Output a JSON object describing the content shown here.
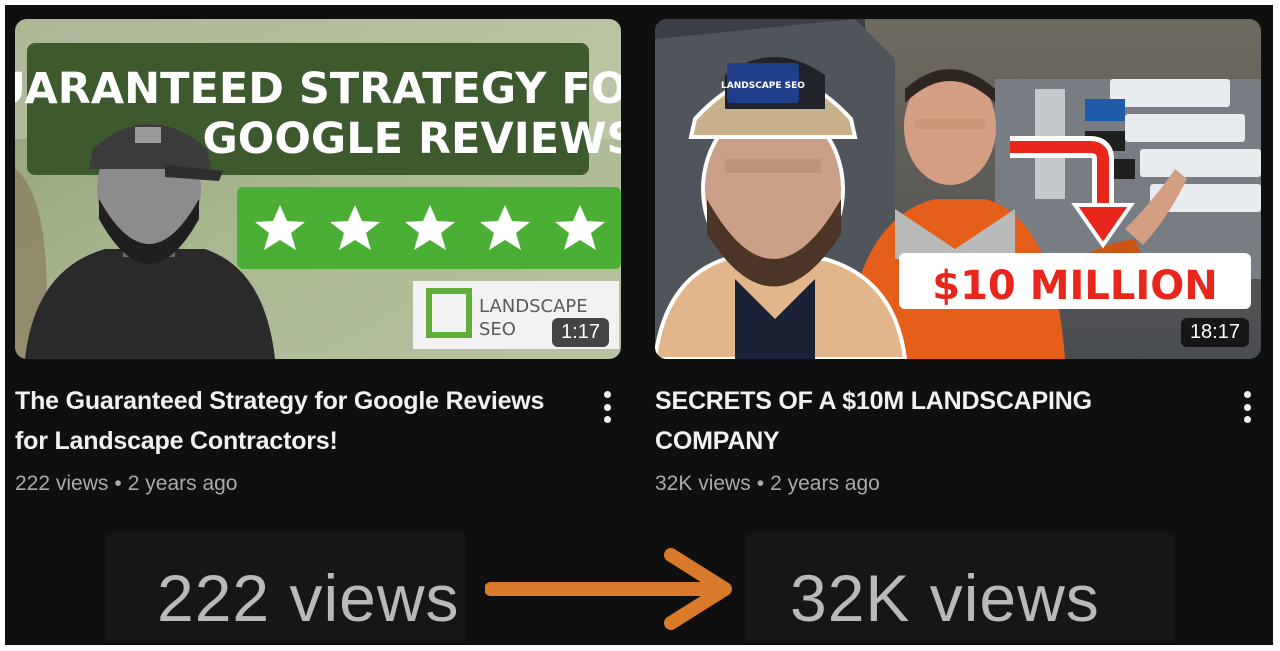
{
  "videos": [
    {
      "thumbnail": {
        "headline_1": "GUARANTEED STRATEGY FOR",
        "headline_2": "GOOGLE REVIEWS",
        "rating_stars": 5,
        "logo_text_1": "LANDSCAPE",
        "logo_text_2": "SEO"
      },
      "duration": "1:17",
      "title": "The Guaranteed Strategy for Google Reviews for Landscape Contractors!",
      "views": "222 views",
      "separator": "•",
      "age": "2 years ago"
    },
    {
      "thumbnail": {
        "overlay_text": "$10 MILLION",
        "cap_text": "LANDSCAPE SEO"
      },
      "duration": "18:17",
      "title": "SECRETS OF A $10M LANDSCAPING COMPANY",
      "views": "32K views",
      "separator": "•",
      "age": "2 years ago"
    }
  ],
  "comparison": {
    "from": "222 views",
    "to": "32K views",
    "arrow_color": "#d97a2b"
  },
  "colors": {
    "background": "#0f0f0f",
    "title_text": "#f1f1f1",
    "meta_text": "#aaaaaa",
    "review_green": "#4caf35",
    "million_red": "#e8261c"
  },
  "icons": {
    "more": "vertical-ellipsis-icon",
    "star": "star-icon",
    "arrow": "right-arrow-icon"
  }
}
